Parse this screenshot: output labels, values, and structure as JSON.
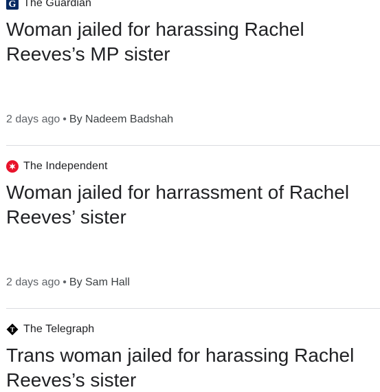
{
  "articles": [
    {
      "source": "The Guardian",
      "source_icon": "guardian-logo-icon",
      "headline": "Woman jailed for harassing Rachel Reeves’s MP sister",
      "time": "2 days ago",
      "author": "By Nadeem Badshah"
    },
    {
      "source": "The Independent",
      "source_icon": "independent-eagle-logo-icon",
      "headline": "Woman jailed for harrassment of Rachel Reeves’ sister",
      "time": "2 days ago",
      "author": "By Sam Hall"
    },
    {
      "source": "The Telegraph",
      "source_icon": "telegraph-logo-icon",
      "headline": "Trans woman jailed for harassing Rachel Reeves’s sister"
    }
  ],
  "meta_separator": "•",
  "colors": {
    "guardian_blue": "#052962",
    "independent_red": "#e8132b",
    "telegraph_black": "#000000",
    "divider": "#dadce0",
    "meta_text": "#5f6368"
  }
}
